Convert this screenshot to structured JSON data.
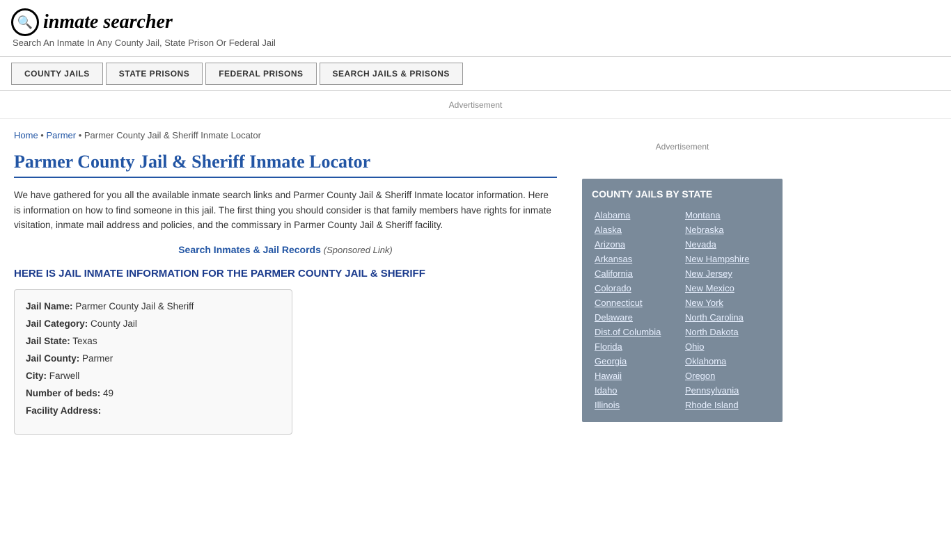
{
  "header": {
    "logo_icon": "🔍",
    "logo_text": "inmate searcher",
    "tagline": "Search An Inmate In Any County Jail, State Prison Or Federal Jail"
  },
  "nav": {
    "items": [
      {
        "label": "COUNTY JAILS",
        "name": "county-jails-nav"
      },
      {
        "label": "STATE PRISONS",
        "name": "state-prisons-nav"
      },
      {
        "label": "FEDERAL PRISONS",
        "name": "federal-prisons-nav"
      },
      {
        "label": "SEARCH JAILS & PRISONS",
        "name": "search-jails-nav"
      }
    ]
  },
  "ad_banner": {
    "label": "Advertisement"
  },
  "breadcrumb": {
    "home_label": "Home",
    "separator1": " • ",
    "parmer_label": "Parmer",
    "separator2": " • ",
    "current": "Parmer County Jail & Sheriff Inmate Locator"
  },
  "page_title": "Parmer County Jail & Sheriff Inmate Locator",
  "description": "We have gathered for you all the available inmate search links and Parmer County Jail & Sheriff Inmate locator information. Here is information on how to find someone in this jail. The first thing you should consider is that family members have rights for inmate visitation, inmate mail address and policies, and the commissary in Parmer County Jail & Sheriff facility.",
  "search_link": {
    "label": "Search Inmates & Jail Records",
    "sponsored": "(Sponsored Link)"
  },
  "info_box_header": "HERE IS JAIL INMATE INFORMATION FOR THE PARMER COUNTY JAIL & SHERIFF",
  "jail_info": {
    "fields": [
      {
        "label": "Jail Name:",
        "value": "Parmer County Jail & Sheriff"
      },
      {
        "label": "Jail Category:",
        "value": "County Jail"
      },
      {
        "label": "Jail State:",
        "value": "Texas"
      },
      {
        "label": "Jail County:",
        "value": "Parmer"
      },
      {
        "label": "City:",
        "value": "Farwell"
      },
      {
        "label": "Number of beds:",
        "value": "49"
      },
      {
        "label": "Facility Address:",
        "value": ""
      }
    ]
  },
  "sidebar_ad": {
    "label": "Advertisement"
  },
  "state_box": {
    "title": "COUNTY JAILS BY STATE",
    "left_column": [
      "Alabama",
      "Alaska",
      "Arizona",
      "Arkansas",
      "California",
      "Colorado",
      "Connecticut",
      "Delaware",
      "Dist.of Columbia",
      "Florida",
      "Georgia",
      "Hawaii",
      "Idaho",
      "Illinois"
    ],
    "right_column": [
      "Montana",
      "Nebraska",
      "Nevada",
      "New Hampshire",
      "New Jersey",
      "New Mexico",
      "New York",
      "North Carolina",
      "North Dakota",
      "Ohio",
      "Oklahoma",
      "Oregon",
      "Pennsylvania",
      "Rhode Island"
    ]
  }
}
